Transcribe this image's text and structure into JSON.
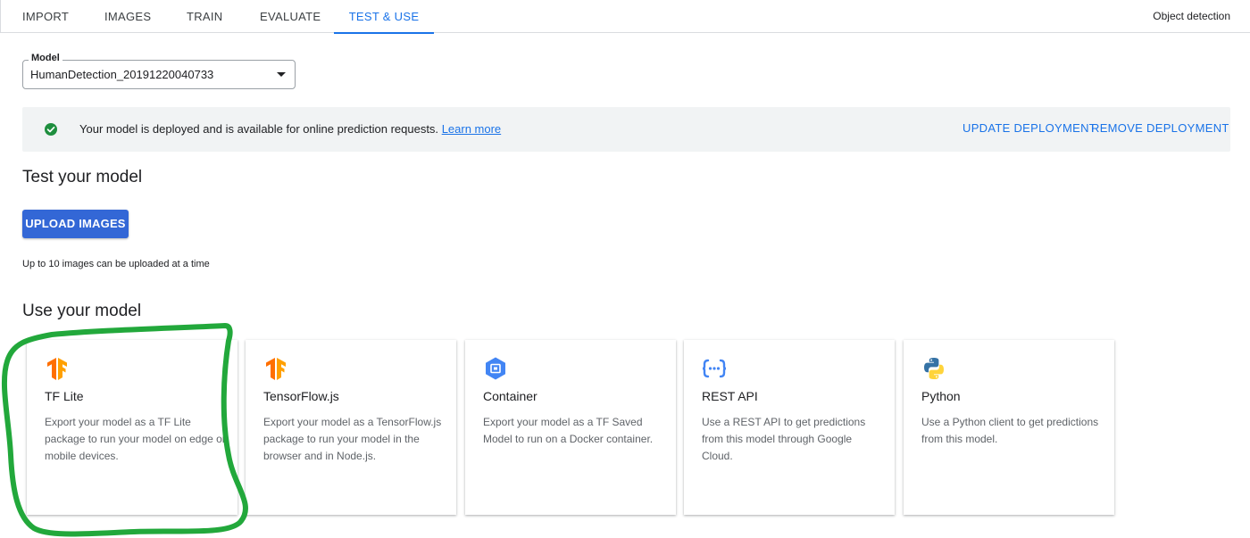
{
  "tabs": [
    {
      "label": "IMPORT",
      "active": false
    },
    {
      "label": "IMAGES",
      "active": false
    },
    {
      "label": "TRAIN",
      "active": false
    },
    {
      "label": "EVALUATE",
      "active": false
    },
    {
      "label": "TEST & USE",
      "active": true
    }
  ],
  "model_type": "Object detection",
  "model_select": {
    "label": "Model",
    "value": "HumanDetection_20191220040733"
  },
  "banner": {
    "icon": "check-circle-icon",
    "message": "Your model is deployed and is available for online prediction requests.",
    "link": "Learn more",
    "update_button": "UPDATE DEPLOYMENT",
    "remove_button": "REMOVE DEPLOYMENT"
  },
  "test_section": {
    "title": "Test your model",
    "upload_button": "UPLOAD IMAGES",
    "helper": "Up to 10 images can be uploaded at a time"
  },
  "use_section": {
    "title": "Use your model",
    "cards": [
      {
        "icon": "tensorflow-icon",
        "title": "TF Lite",
        "description": "Export your model as a TF Lite package to run your model on edge or mobile devices."
      },
      {
        "icon": "tensorflow-icon",
        "title": "TensorFlow.js",
        "description": "Export your model as a TensorFlow.js package to run your model in the browser and in Node.js."
      },
      {
        "icon": "container-icon",
        "title": "Container",
        "description": "Export your model as a TF Saved Model to run on a Docker container."
      },
      {
        "icon": "rest-api-icon",
        "title": "REST API",
        "description": "Use a REST API to get predictions from this model through Google Cloud."
      },
      {
        "icon": "python-icon",
        "title": "Python",
        "description": "Use a Python client to get predictions from this model."
      }
    ]
  },
  "colors": {
    "accent": "#1a73e8",
    "button": "#3367d6",
    "success": "#1e8e3e",
    "annotation": "#22a83b",
    "tensorflow": "#ff6f00",
    "python_blue": "#3572a5",
    "python_yellow": "#ffd43b"
  }
}
